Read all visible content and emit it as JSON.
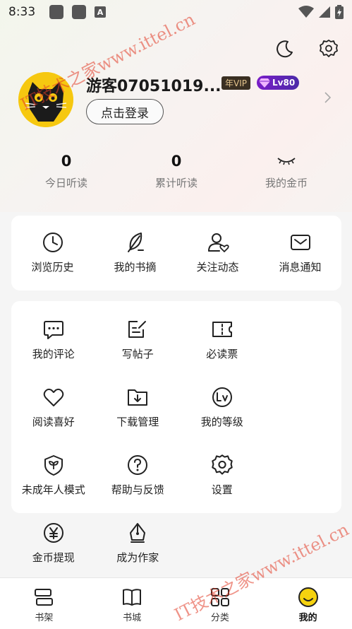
{
  "status_bar": {
    "time": "8:33",
    "a_icon": "A"
  },
  "top_actions": {
    "icons": [
      "moon-icon",
      "gear-icon"
    ]
  },
  "profile": {
    "name": "游客07051019...",
    "vip_badge": "年VIP",
    "level_badge": "Lv80",
    "login_button": "点击登录"
  },
  "stats": [
    {
      "value": "0",
      "label": "今日听读"
    },
    {
      "value": "0",
      "label": "累计听读"
    },
    {
      "value": "",
      "label": "我的金币"
    }
  ],
  "quick_actions": [
    {
      "icon": "clock-icon",
      "label": "浏览历史"
    },
    {
      "icon": "feather-icon",
      "label": "我的书摘"
    },
    {
      "icon": "user-heart-icon",
      "label": "关注动态"
    },
    {
      "icon": "mail-icon",
      "label": "消息通知"
    }
  ],
  "services": [
    {
      "icon": "comment-icon",
      "label": "我的评论"
    },
    {
      "icon": "edit-icon",
      "label": "写帖子"
    },
    {
      "icon": "ticket-icon",
      "label": "必读票"
    },
    {
      "icon": "heart-icon",
      "label": "阅读喜好"
    },
    {
      "icon": "download-folder-icon",
      "label": "下载管理"
    },
    {
      "icon": "level-icon",
      "label": "我的等级"
    },
    {
      "icon": "shield-leaf-icon",
      "label": "未成年人模式"
    },
    {
      "icon": "help-icon",
      "label": "帮助与反馈"
    },
    {
      "icon": "gear-icon",
      "label": "设置"
    },
    {
      "icon": "yen-icon",
      "label": "金币提现"
    },
    {
      "icon": "pen-nib-icon",
      "label": "成为作家"
    }
  ],
  "bottom_nav": [
    {
      "icon": "bookshelf-icon",
      "label": "书架",
      "active": false
    },
    {
      "icon": "open-book-icon",
      "label": "书城",
      "active": false
    },
    {
      "icon": "category-icon",
      "label": "分类",
      "active": false
    },
    {
      "icon": "smile-face-icon",
      "label": "我的",
      "active": true
    }
  ],
  "watermarks": [
    "IT技术之家www.ittel.cn",
    "IT技术之家www.ittel.cn"
  ]
}
